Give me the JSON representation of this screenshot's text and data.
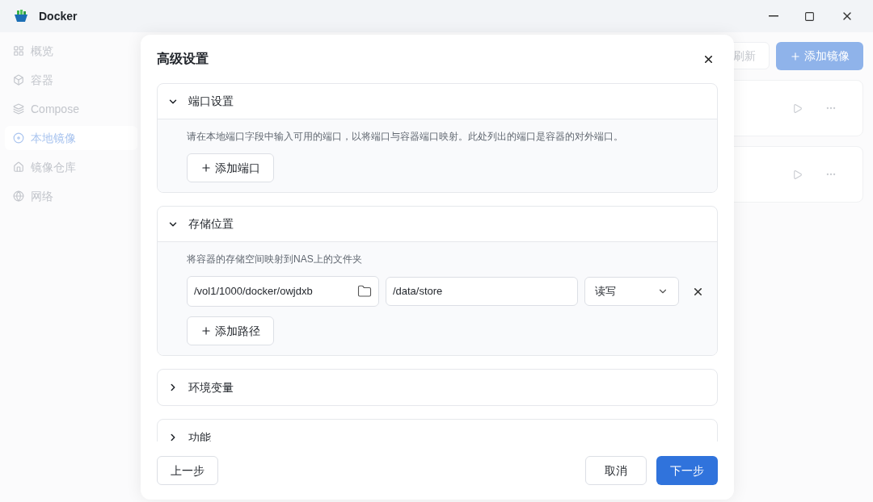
{
  "window": {
    "title": "Docker"
  },
  "sidebar": {
    "items": [
      {
        "label": "概览",
        "selected": false
      },
      {
        "label": "容器",
        "selected": false
      },
      {
        "label": "Compose",
        "selected": false
      },
      {
        "label": "本地镜像",
        "selected": true
      },
      {
        "label": "镜像仓库",
        "selected": false
      },
      {
        "label": "网络",
        "selected": false
      }
    ]
  },
  "toolbar": {
    "refresh": "刷新",
    "add": "添加镜像"
  },
  "image_cards": [
    {
      "kind": "card"
    },
    {
      "kind": "card"
    }
  ],
  "dialog": {
    "title": "高级设置",
    "sections": [
      {
        "title": "端口设置",
        "expanded": true,
        "description": "请在本地端口字段中输入可用的端口，以将端口与容器端口映射。此处列出的端口是容器的对外端口。",
        "add_button": "添加端口"
      },
      {
        "title": "存储位置",
        "expanded": true,
        "description": "将容器的存储空间映射到NAS上的文件夹",
        "rows": [
          {
            "host_path": "/vol1/1000/docker/owjdxb",
            "container_path": "/data/store",
            "permission": "读写"
          }
        ],
        "add_button": "添加路径"
      },
      {
        "title": "环境变量",
        "expanded": false
      },
      {
        "title": "功能",
        "expanded": false
      }
    ],
    "footer": {
      "back": "上一步",
      "cancel": "取消",
      "next": "下一步"
    }
  }
}
